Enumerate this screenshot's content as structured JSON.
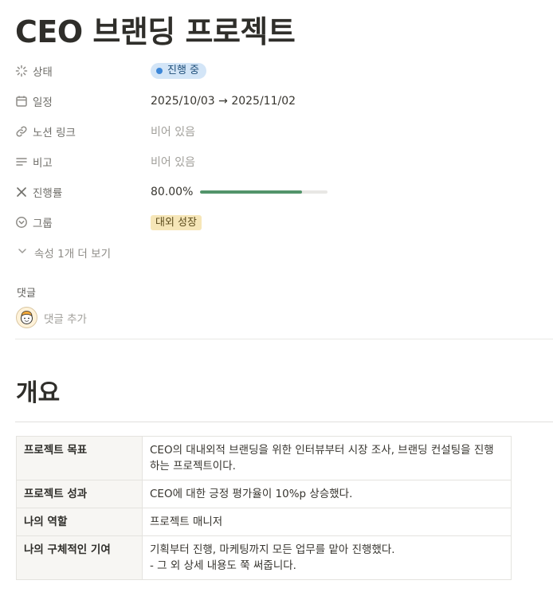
{
  "page": {
    "title": "CEO 브랜딩 프로젝트"
  },
  "properties": {
    "status": {
      "label": "상태",
      "value": "진행 중",
      "icon": "status-loader-icon",
      "color": "#3d87d8"
    },
    "schedule": {
      "label": "일정",
      "value": "2025/10/03 → 2025/11/02",
      "icon": "calendar-icon"
    },
    "notion_link": {
      "label": "노션 링크",
      "value": "비어 있음",
      "icon": "link-icon"
    },
    "remarks": {
      "label": "비고",
      "value": "비어 있음",
      "icon": "text-lines-icon"
    },
    "progress": {
      "label": "진행률",
      "value": "80.00%",
      "fraction": 0.8,
      "icon": "formula-x-icon",
      "color": "#52946a"
    },
    "group": {
      "label": "그룹",
      "value": "대외 성장",
      "icon": "select-arrow-icon"
    },
    "more": {
      "label": "속성 1개 더 보기",
      "icon": "chevron-down-icon"
    }
  },
  "comments": {
    "label": "댓글",
    "placeholder": "댓글 추가",
    "avatar_icon": "user-avatar-icon"
  },
  "overview": {
    "heading": "개요",
    "rows": [
      {
        "key": "프로젝트 목표",
        "value": "CEO의 대내외적 브랜딩을 위한 인터뷰부터 시장 조사, 브랜딩 컨설팅을 진행하는 프로젝트이다."
      },
      {
        "key": "프로젝트 성과",
        "value": "CEO에 대한 긍정 평가율이 10%p 상승했다."
      },
      {
        "key": "나의 역할",
        "value": "프로젝트 매니저"
      },
      {
        "key": "나의 구체적인 기여",
        "value": "기획부터 진행, 마케팅까지 모든 업무를 맡아 진행했다.\n- 그 외 상세 내용도 쭉 써줍니다."
      }
    ]
  }
}
